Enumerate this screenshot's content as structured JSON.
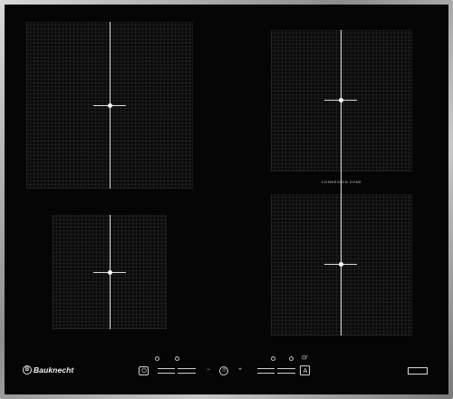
{
  "appliance": {
    "brand": "Bauknecht",
    "brand_mark": "B",
    "connection_zone_label": "CONNEXION ZONE"
  },
  "zones": [
    {
      "name": "rear-left"
    },
    {
      "name": "front-left"
    },
    {
      "name": "rear-right"
    },
    {
      "name": "front-right"
    }
  ],
  "controls": {
    "power_icon": "power-icon",
    "timer_icon": "timer-icon",
    "minus_symbol": "−",
    "plus_symbol": "+",
    "auto_label": "A",
    "pause_symbol": "II"
  },
  "colors": {
    "glass": "#050505",
    "frame": "#a0a0a0",
    "lines": "#dcdcdc"
  }
}
